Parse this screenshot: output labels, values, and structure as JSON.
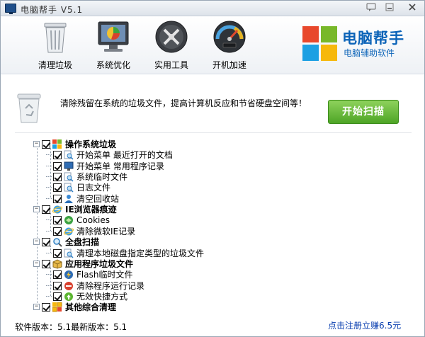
{
  "window": {
    "title": "电脑帮手 V5.1"
  },
  "toolbar": {
    "items": [
      {
        "label": "清理垃圾",
        "icon": "trash-bin-icon"
      },
      {
        "label": "系统优化",
        "icon": "monitor-chart-icon"
      },
      {
        "label": "实用工具",
        "icon": "tools-icon"
      },
      {
        "label": "开机加速",
        "icon": "speedometer-icon"
      }
    ]
  },
  "brand": {
    "title": "电脑帮手",
    "subtitle": "电脑辅助软件"
  },
  "banner": {
    "text": "清除残留在系统的垃圾文件，提高计算机反应和节省硬盘空间等！",
    "scan_button": "开始扫描"
  },
  "tree": [
    {
      "label": "操作系统垃圾",
      "icon": "windows-icon",
      "group": true
    },
    {
      "label": "开始菜单 最近打开的文档",
      "icon": "search-doc-icon"
    },
    {
      "label": "开始菜单 常用程序记录",
      "icon": "monitor-icon"
    },
    {
      "label": "系统临时文件",
      "icon": "search-doc-icon"
    },
    {
      "label": "日志文件",
      "icon": "search-doc-icon"
    },
    {
      "label": "清空回收站",
      "icon": "user-icon"
    },
    {
      "label": "IE浏览器痕迹",
      "icon": "ie-icon",
      "group": true
    },
    {
      "label": "Cookies",
      "icon": "cookie-icon"
    },
    {
      "label": "清除微软IE记录",
      "icon": "ie-icon"
    },
    {
      "label": "全盘扫描",
      "icon": "magnifier-icon",
      "group": true
    },
    {
      "label": "清理本地磁盘指定类型的垃圾文件",
      "icon": "search-doc-icon"
    },
    {
      "label": "应用程序垃圾文件",
      "icon": "box-icon",
      "group": true
    },
    {
      "label": "Flash临时文件",
      "icon": "flash-icon"
    },
    {
      "label": "清除程序运行记录",
      "icon": "stop-icon"
    },
    {
      "label": "无效快捷方式",
      "icon": "shortcut-icon"
    },
    {
      "label": "其他综合清理",
      "icon": "grid-icon",
      "group": true
    }
  ],
  "footer": {
    "version": "软件版本：5.1最新版本：5.1",
    "register_link": "点击注册立赚6.5元"
  },
  "colors": {
    "accent": "#0b63b8",
    "scan_button": "#5cb531",
    "link": "#0a3fb0"
  }
}
